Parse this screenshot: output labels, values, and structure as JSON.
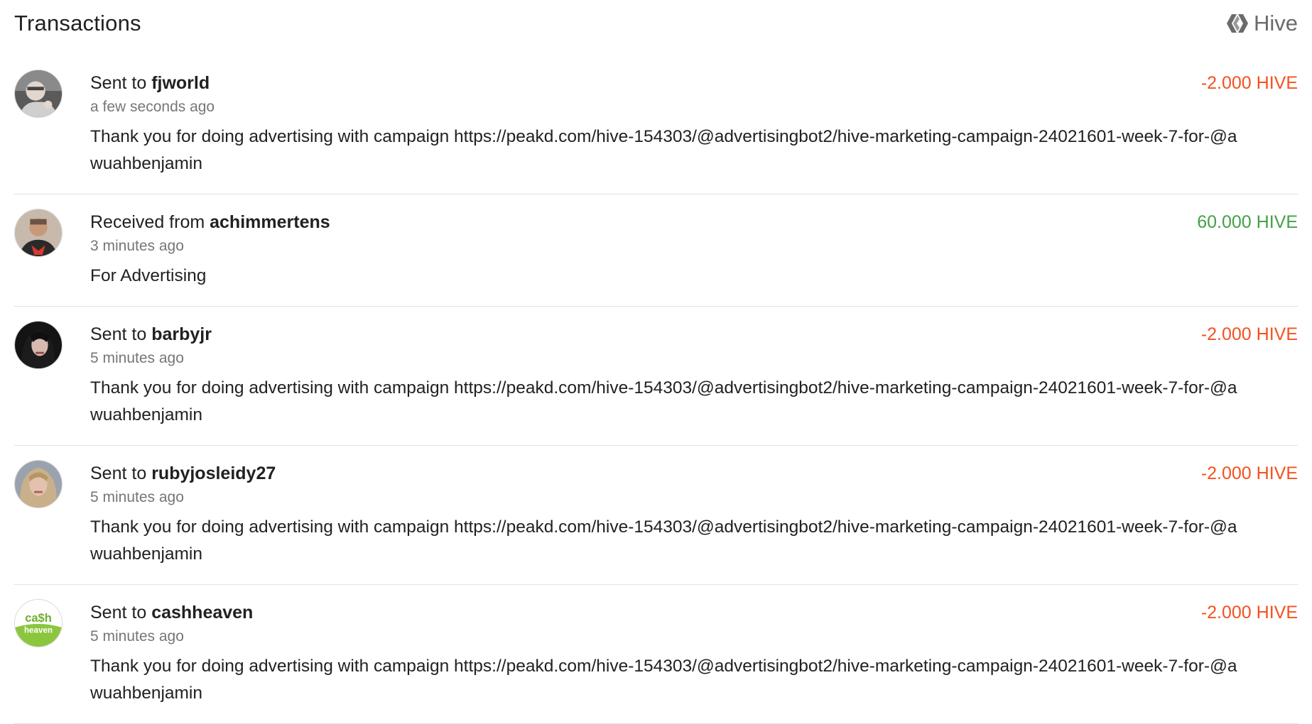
{
  "header": {
    "title": "Transactions",
    "brand_label": "Hive",
    "brand_icon": "hive-logo-icon"
  },
  "colors": {
    "negative": "#f4511e",
    "positive": "#43a047"
  },
  "transactions": [
    {
      "direction": "Sent to",
      "user": "fjworld",
      "time": "a few seconds ago",
      "memo": "Thank you for doing advertising with campaign https://peakd.com/hive-154303/@advertisingbot2/hive-marketing-campaign-24021601-week-7-for-@awuahbenjamin",
      "amount": "-2.000 HIVE",
      "sign": "negative",
      "avatar": "user-photo-avatar"
    },
    {
      "direction": "Received from",
      "user": "achimmertens",
      "time": "3 minutes ago",
      "memo": "For Advertising",
      "amount": "60.000 HIVE",
      "sign": "positive",
      "avatar": "user-photo-avatar"
    },
    {
      "direction": "Sent to",
      "user": "barbyjr",
      "time": "5 minutes ago",
      "memo": "Thank you for doing advertising with campaign https://peakd.com/hive-154303/@advertisingbot2/hive-marketing-campaign-24021601-week-7-for-@awuahbenjamin",
      "amount": "-2.000 HIVE",
      "sign": "negative",
      "avatar": "user-photo-avatar"
    },
    {
      "direction": "Sent to",
      "user": "rubyjosleidy27",
      "time": "5 minutes ago",
      "memo": "Thank you for doing advertising with campaign https://peakd.com/hive-154303/@advertisingbot2/hive-marketing-campaign-24021601-week-7-for-@awuahbenjamin",
      "amount": "-2.000 HIVE",
      "sign": "negative",
      "avatar": "user-photo-avatar"
    },
    {
      "direction": "Sent to",
      "user": "cashheaven",
      "time": "5 minutes ago",
      "memo": "Thank you for doing advertising with campaign https://peakd.com/hive-154303/@advertisingbot2/hive-marketing-campaign-24021601-week-7-for-@awuahbenjamin",
      "amount": "-2.000 HIVE",
      "sign": "negative",
      "avatar": "cash-heaven-logo",
      "logo_text_top": "ca$h",
      "logo_text_bottom": "heaven"
    }
  ]
}
